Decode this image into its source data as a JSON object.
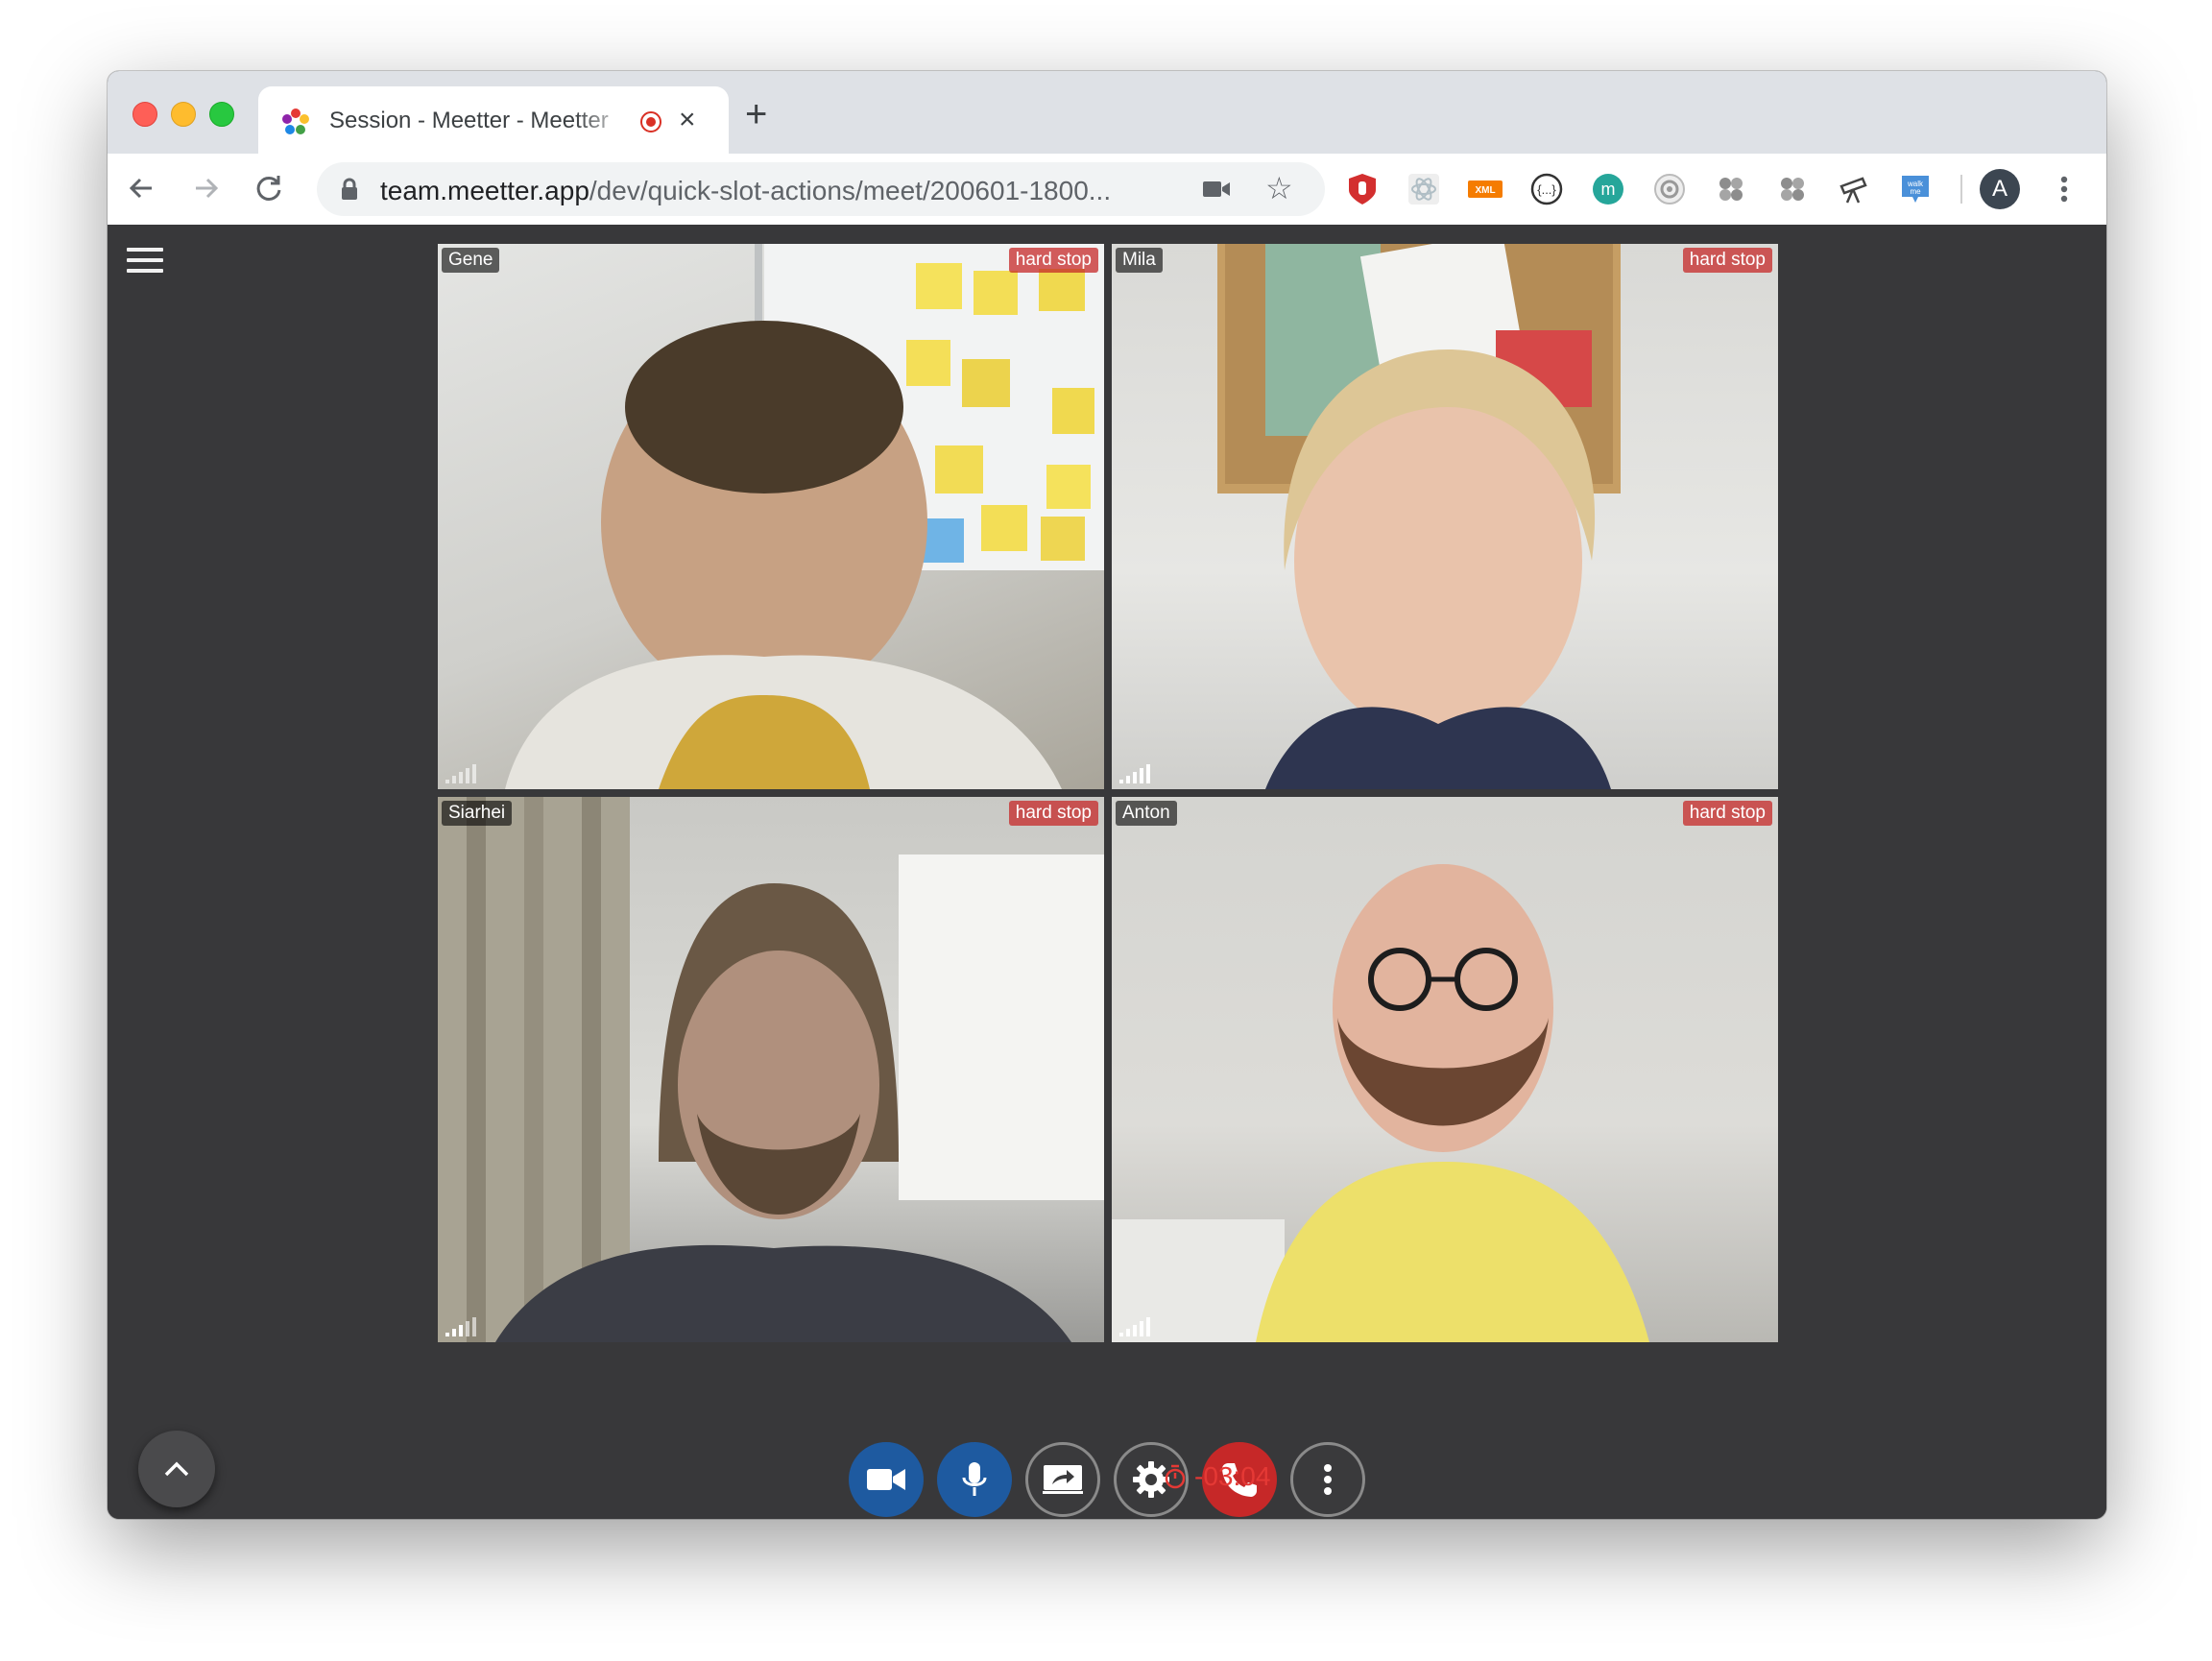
{
  "browser": {
    "tab": {
      "title": "Session - Meetter - Meetter"
    },
    "new_tab_label": "+",
    "address": {
      "host": "team.meetter.app",
      "path": "/dev/quick-slot-actions/meet/200601-1800..."
    },
    "profile_initial": "A",
    "extensions": [
      "ublock-icon",
      "react-devtools-icon",
      "xml-icon",
      "json-icon",
      "meetter-m-icon",
      "camera-lens-icon",
      "puzzle-flower-icon",
      "puzzle-flower-icon-2",
      "telescope-icon",
      "walkme-icon"
    ]
  },
  "meeting": {
    "participants": [
      {
        "name": "Gene",
        "badge": "hard stop"
      },
      {
        "name": "Mila",
        "badge": "hard stop"
      },
      {
        "name": "Siarhei",
        "badge": "hard stop"
      },
      {
        "name": "Anton",
        "badge": "hard stop"
      }
    ],
    "controls": [
      "camera",
      "microphone",
      "share-screen",
      "settings",
      "hang-up",
      "more"
    ],
    "timer": "-03:04"
  },
  "colors": {
    "app_background": "#38383a",
    "control_blue": "#1e5aa0",
    "hangup_red": "#c62828",
    "timer_red": "#e53935",
    "hard_stop_badge": "#c62828"
  }
}
